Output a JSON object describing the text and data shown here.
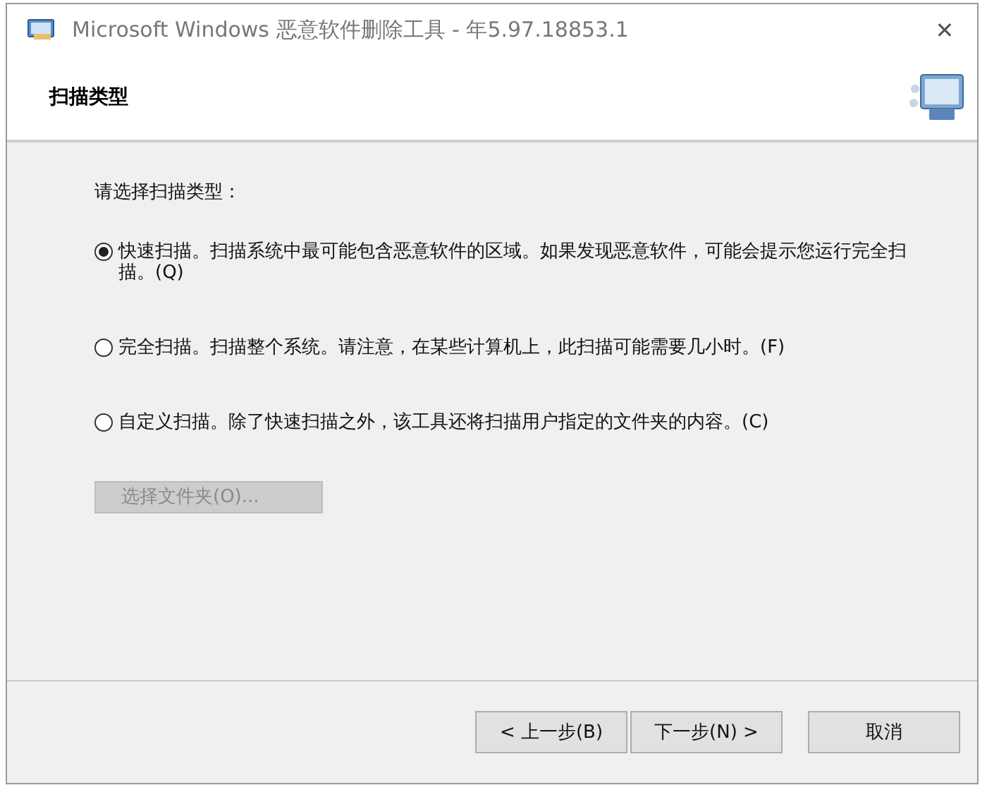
{
  "window": {
    "title": "Microsoft Windows 恶意软件删除工具 - 年5.97.18853.1",
    "close": "✕"
  },
  "header": {
    "title": "扫描类型"
  },
  "prompt": "请选择扫描类型：",
  "options": [
    {
      "label": "快速扫描。扫描系统中最可能包含恶意软件的区域。如果发现恶意软件，可能会提示您运行完全扫描。(Q)",
      "selected": true
    },
    {
      "label": "完全扫描。扫描整个系统。请注意，在某些计算机上，此扫描可能需要几小时。(F)",
      "selected": false
    },
    {
      "label": "自定义扫描。除了快速扫描之外，该工具还将扫描用户指定的文件夹的内容。(C)",
      "selected": false
    }
  ],
  "folder_button": {
    "label": "选择文件夹(O)...",
    "disabled": true
  },
  "buttons": [
    {
      "label": "< 上一步(B)"
    },
    {
      "label": "下一步(N) >"
    },
    {
      "label": "取消"
    }
  ]
}
